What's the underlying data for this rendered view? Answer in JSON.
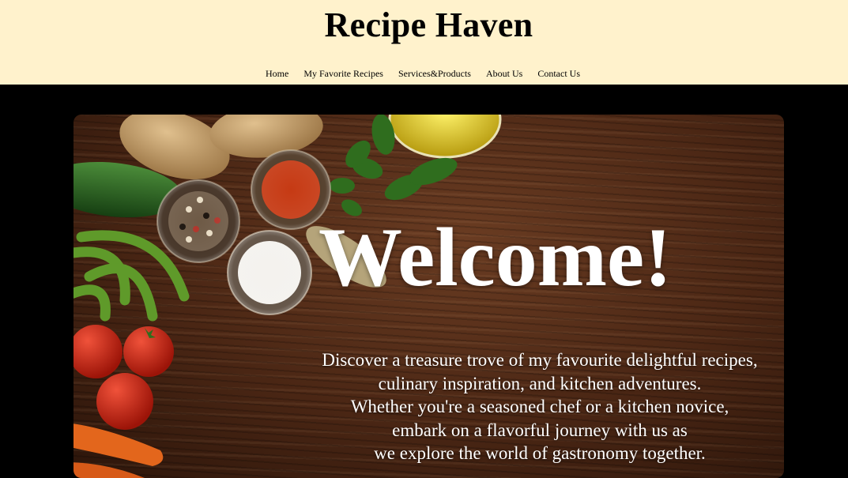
{
  "header": {
    "site_title": "Recipe Haven"
  },
  "nav": {
    "items": [
      {
        "label": "Home"
      },
      {
        "label": "My Favorite Recipes"
      },
      {
        "label": "Services&Products"
      },
      {
        "label": "About Us"
      },
      {
        "label": "Contact Us"
      }
    ]
  },
  "hero": {
    "heading": "Welcome!",
    "tagline_lines": [
      "Discover a treasure trove of my favourite delightful recipes,",
      "culinary inspiration, and kitchen adventures.",
      "Whether you're a seasoned chef or a kitchen novice,",
      "embark on a flavorful journey with us as",
      "we explore the world of gastronomy together."
    ]
  },
  "colors": {
    "header_bg": "#fff2cc",
    "page_bg": "#000000",
    "wood": "#4a2614"
  }
}
